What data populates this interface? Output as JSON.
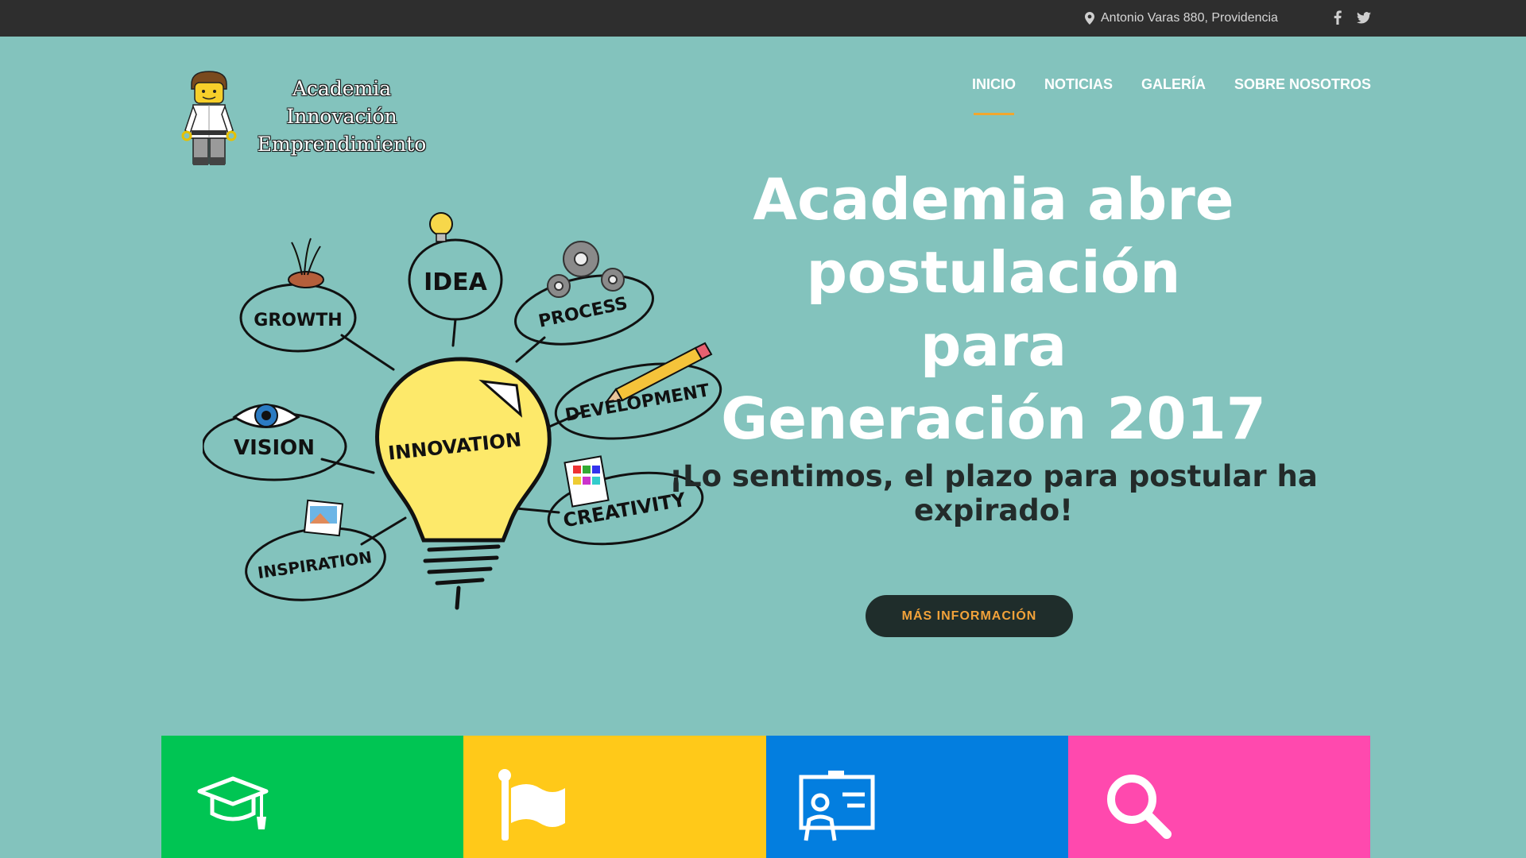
{
  "topbar": {
    "address": "Antonio Varas 880, Providencia",
    "icons": [
      "map-pin-icon",
      "facebook-icon",
      "twitter-icon"
    ],
    "background": "#2e2e2e"
  },
  "logo": {
    "line1": "Academia",
    "line2": "Innovación",
    "line3": "Emprendimiento"
  },
  "nav": {
    "items": [
      {
        "label": "INICIO",
        "active": true
      },
      {
        "label": "NOTICIAS",
        "active": false
      },
      {
        "label": "GALERÍA",
        "active": false
      },
      {
        "label": "SOBRE NOSOTROS",
        "active": false
      }
    ],
    "active_underline_color": "#f1a72e"
  },
  "hero": {
    "title_line1": "Academia abre postulación",
    "title_line2": "para",
    "title_line3": "Generación 2017",
    "subtitle": "¡Lo sentimos, el plazo para postular ha expirado!",
    "cta_label": "MÁS INFORMACIÓN",
    "background": "#83c3bd",
    "illustration_words": [
      "IDEA",
      "GROWTH",
      "PROCESS",
      "DEVELOPMENT",
      "VISION",
      "INNOVATION",
      "CREATIVITY",
      "INSPIRATION"
    ]
  },
  "features": [
    {
      "icon": "graduation-cap-icon",
      "color": "#00c553"
    },
    {
      "icon": "flag-icon",
      "color": "#ffc919"
    },
    {
      "icon": "teacher-board-icon",
      "color": "#037edf"
    },
    {
      "icon": "search-icon",
      "color": "#ff49ae"
    }
  ]
}
